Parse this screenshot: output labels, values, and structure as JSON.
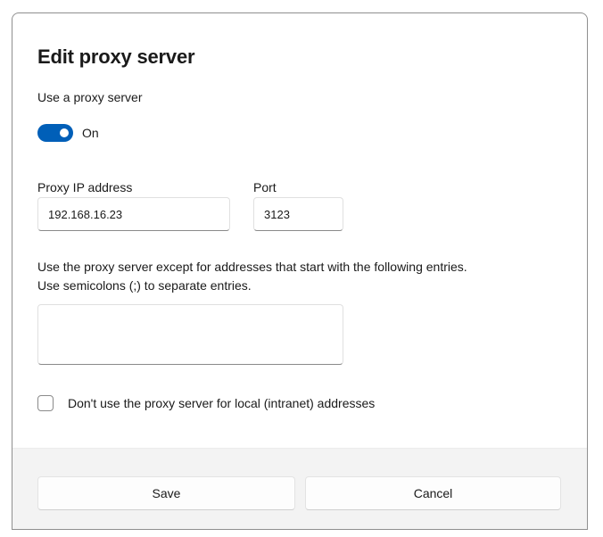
{
  "dialog": {
    "title": "Edit proxy server",
    "use_proxy_label": "Use a proxy server",
    "toggle": {
      "on": true,
      "state_label": "On"
    },
    "ip": {
      "label": "Proxy IP address",
      "value": "192.168.16.23"
    },
    "port": {
      "label": "Port",
      "value": "3123"
    },
    "exceptions": {
      "label_line1": "Use the proxy server except for addresses that start with the following entries.",
      "label_line2": "Use semicolons (;) to separate entries.",
      "value": ""
    },
    "local_bypass": {
      "checked": false,
      "label": "Don't use the proxy server for local (intranet) addresses"
    },
    "buttons": {
      "save": "Save",
      "cancel": "Cancel"
    }
  },
  "colors": {
    "accent": "#005fb8",
    "footer_background": "#f3f3f3"
  }
}
